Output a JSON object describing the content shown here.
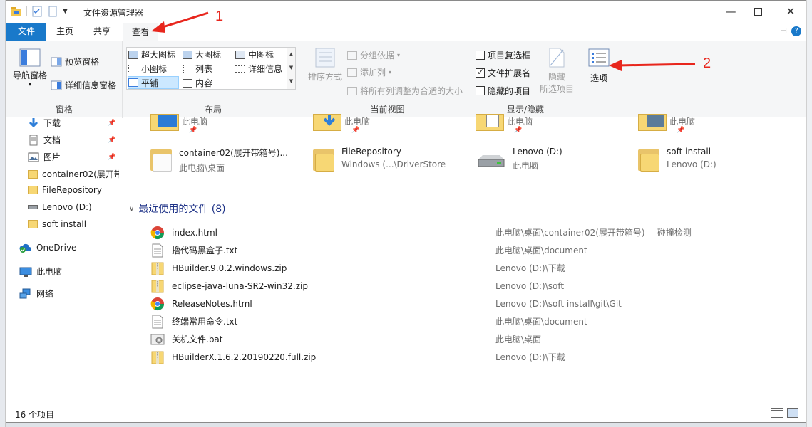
{
  "window": {
    "title": "文件资源管理器"
  },
  "tabs": [
    {
      "label": "文件"
    },
    {
      "label": "主页"
    },
    {
      "label": "共享"
    },
    {
      "label": "查看"
    }
  ],
  "ribbon": {
    "panes_group": {
      "label": "窗格",
      "nav_pane": "导航窗格",
      "preview_pane": "预览窗格",
      "details_pane": "详细信息窗格"
    },
    "layout_group": {
      "label": "布局",
      "options": [
        "超大图标",
        "大图标",
        "中图标",
        "小图标",
        "列表",
        "详细信息",
        "平铺",
        "内容"
      ],
      "selected": "平铺"
    },
    "current_view_group": {
      "label": "当前视图",
      "sort_by": "排序方式",
      "group_by": "分组依据",
      "add_column": "添加列",
      "fit_columns": "将所有列调整为合适的大小"
    },
    "show_hide_group": {
      "label": "显示/隐藏",
      "item_checkboxes": "项目复选框",
      "file_extensions": "文件扩展名",
      "hidden_items": "隐藏的项目",
      "hide_selected_line1": "隐藏",
      "hide_selected_line2": "所选项目",
      "file_extensions_checked": true
    },
    "options": {
      "label": "选项"
    }
  },
  "nav": {
    "quick_items": [
      {
        "label": "下载",
        "pinned": true
      },
      {
        "label": "文档",
        "pinned": true
      },
      {
        "label": "图片",
        "pinned": true
      },
      {
        "label": "container02(展开带"
      },
      {
        "label": "FileRepository"
      },
      {
        "label": "Lenovo (D:)"
      },
      {
        "label": "soft install"
      }
    ],
    "onedrive": "OneDrive",
    "this_pc": "此电脑",
    "network": "网络"
  },
  "quick_access": {
    "top_row_sub": [
      "此电脑",
      "此电脑",
      "此电脑",
      "此电脑"
    ],
    "tiles": [
      {
        "name": "container02(展开带箱号)...",
        "sub": "此电脑\\桌面"
      },
      {
        "name": "FileRepository",
        "sub": "Windows (...\\DriverStore"
      },
      {
        "name": "Lenovo (D:)",
        "sub": "此电脑"
      },
      {
        "name": "soft install",
        "sub": "Lenovo (D:)"
      }
    ]
  },
  "recent": {
    "header": "最近使用的文件 (8)",
    "files": [
      {
        "name": "index.html",
        "path": "此电脑\\桌面\\container02(展开带箱号)----碰撞检测",
        "icon": "chrome-icon"
      },
      {
        "name": "撸代码黑盒子.txt",
        "path": "此电脑\\桌面\\document",
        "icon": "text-file-icon"
      },
      {
        "name": "HBuilder.9.0.2.windows.zip",
        "path": "Lenovo (D:)\\下载",
        "icon": "zip-icon"
      },
      {
        "name": "eclipse-java-luna-SR2-win32.zip",
        "path": "Lenovo (D:)\\soft",
        "icon": "zip-icon"
      },
      {
        "name": "ReleaseNotes.html",
        "path": "Lenovo (D:)\\soft install\\git\\Git",
        "icon": "chrome-icon"
      },
      {
        "name": "终端常用命令.txt",
        "path": "此电脑\\桌面\\document",
        "icon": "text-file-icon"
      },
      {
        "name": "关机文件.bat",
        "path": "此电脑\\桌面",
        "icon": "bat-icon"
      },
      {
        "name": "HBuilderX.1.6.2.20190220.full.zip",
        "path": "Lenovo (D:)\\下载",
        "icon": "zip-icon"
      }
    ]
  },
  "status": {
    "count": "16 个项目"
  },
  "annotations": {
    "one": "1",
    "two": "2",
    "color": "#e8261d"
  },
  "colors": {
    "file_tab": "#1979ca",
    "selected": "#cce8ff",
    "header": "#1e3287"
  }
}
